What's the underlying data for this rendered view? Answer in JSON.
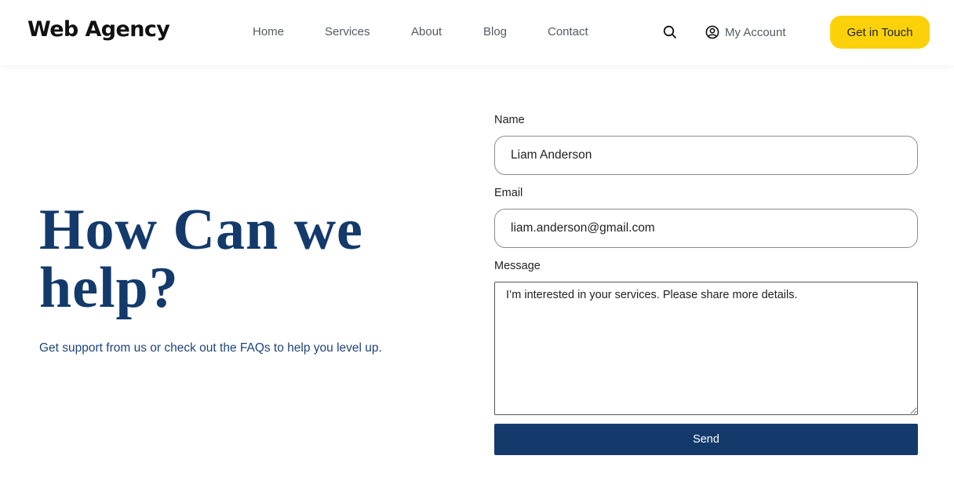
{
  "header": {
    "logo": "Web Agency",
    "nav": [
      "Home",
      "Services",
      "About",
      "Blog",
      "Contact"
    ],
    "search_icon": "search-icon",
    "account_icon": "user-circle-icon",
    "account_label": "My Account",
    "cta_label": "Get in Touch"
  },
  "hero": {
    "title": "How Can we help?",
    "subtitle": "Get support from us or check out the FAQs to help you level up."
  },
  "form": {
    "name_label": "Name",
    "name_value": "Liam Anderson",
    "email_label": "Email",
    "email_value": "liam.anderson@gmail.com",
    "message_label": "Message",
    "message_value": "I’m interested in your services. Please share more details.",
    "send_label": "Send"
  },
  "colors": {
    "brand_navy": "#133a6b",
    "cta_yellow": "#fbd20a",
    "nav_text": "#555a63"
  }
}
